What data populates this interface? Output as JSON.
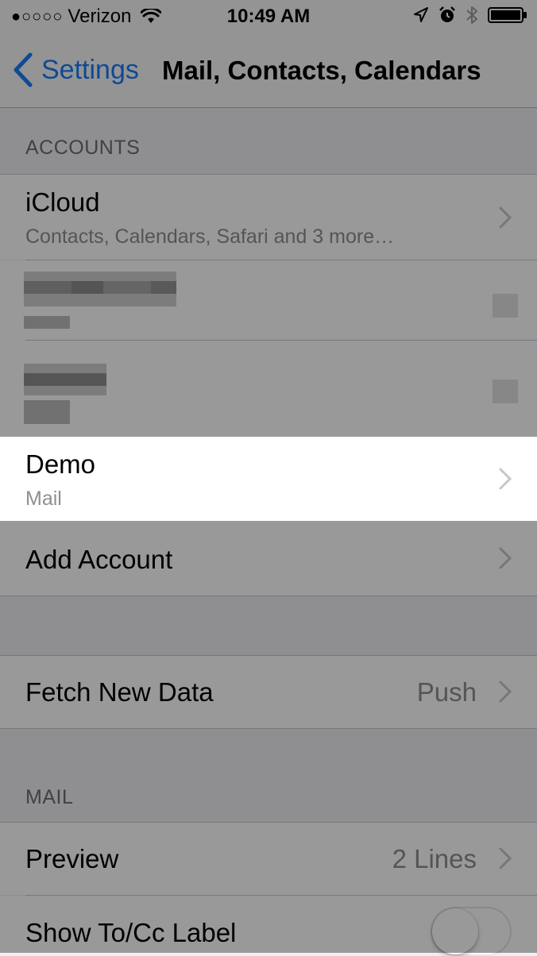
{
  "status_bar": {
    "signal_dots": "●○○○○",
    "carrier": "Verizon",
    "time": "10:49 AM",
    "icons": [
      "wifi-icon",
      "location-icon",
      "alarm-icon",
      "bluetooth-icon",
      "battery-icon"
    ]
  },
  "nav": {
    "back_label": "Settings",
    "title": "Mail, Contacts, Calendars"
  },
  "accounts_section": {
    "header": "ACCOUNTS",
    "items": [
      {
        "title": "iCloud",
        "subtitle": "Contacts, Calendars, Safari and 3 more…"
      },
      {
        "title": "Demo",
        "subtitle": "Mail"
      }
    ],
    "add_account": "Add Account"
  },
  "fetch": {
    "label": "Fetch New Data",
    "value": "Push"
  },
  "mail_section": {
    "header": "MAIL",
    "preview_label": "Preview",
    "preview_value": "2 Lines",
    "show_tocc_label": "Show To/Cc Label",
    "show_tocc_on": false
  },
  "colors": {
    "accent": "#1a7cf5",
    "dim_overlay": "rgba(0,0,0,0.40)"
  }
}
